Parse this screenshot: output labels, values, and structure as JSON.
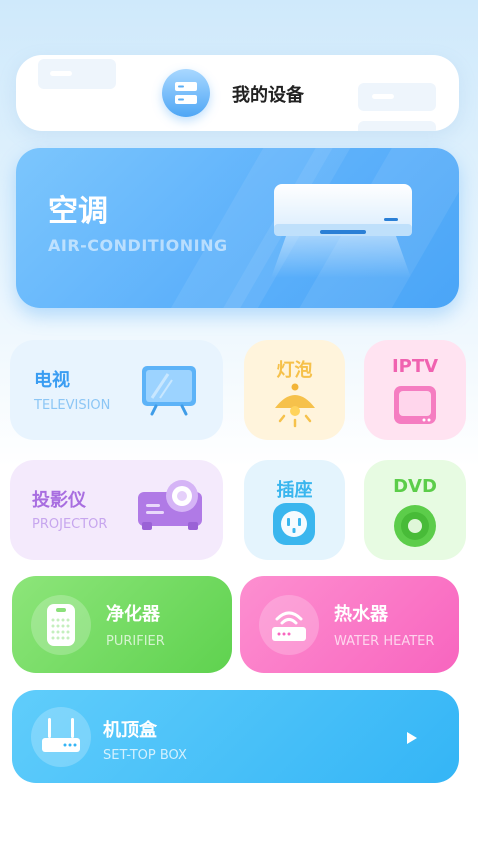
{
  "header": {
    "title": "我的设备",
    "icon": "server-icon"
  },
  "air_conditioning": {
    "title": "空调",
    "subtitle": "AIR-CONDITIONING",
    "icon": "air-conditioner-icon"
  },
  "television": {
    "title": "电视",
    "subtitle": "TELEVISION",
    "icon": "tv-icon"
  },
  "bulb": {
    "title": "灯泡",
    "icon": "bulb-icon"
  },
  "iptv": {
    "title": "IPTV",
    "icon": "iptv-box-icon"
  },
  "projector": {
    "title": "投影仪",
    "subtitle": "PROJECTOR",
    "icon": "projector-icon"
  },
  "socket": {
    "title": "插座",
    "icon": "socket-icon"
  },
  "dvd": {
    "title": "DVD",
    "icon": "disc-icon"
  },
  "purifier": {
    "title": "净化器",
    "subtitle": "PURIFIER",
    "icon": "purifier-icon"
  },
  "water_heater": {
    "title": "热水器",
    "subtitle": "WATER HEATER",
    "icon": "router-icon"
  },
  "set_top_box": {
    "title": "机顶盒",
    "subtitle": "SET-TOP BOX",
    "icon": "router-box-icon",
    "action_icon": "play-icon"
  },
  "colors": {
    "accent_blue": "#4aa5f7",
    "bulb_yellow": "#f6c14b",
    "iptv_pink": "#f062b0",
    "projector_purple": "#b07ae6",
    "socket_blue": "#3ab6ee",
    "dvd_green": "#5ccd4a",
    "purifier_green": "#6fdc5e",
    "heater_pink": "#f96cc2",
    "stb_blue": "#3fbcf8"
  }
}
